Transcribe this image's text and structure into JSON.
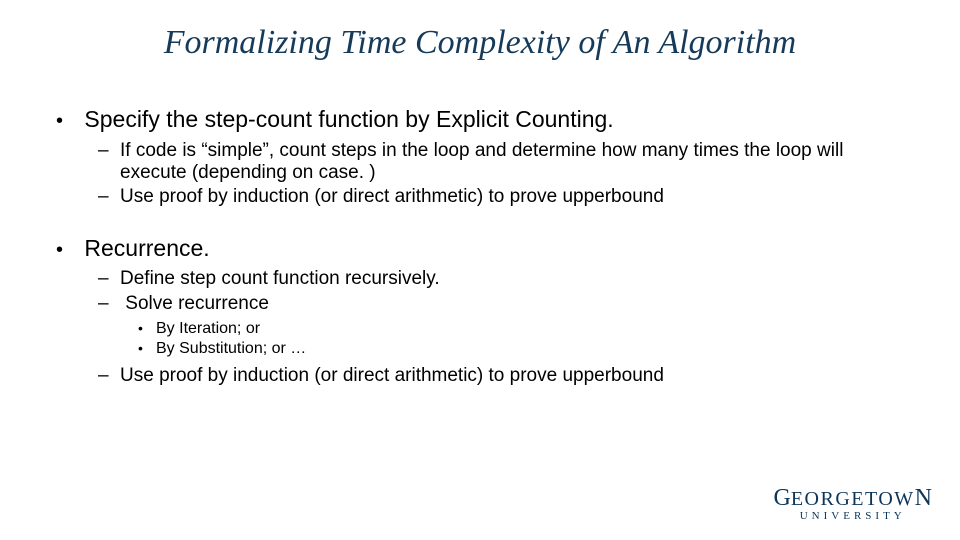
{
  "title": "Formalizing Time Complexity of An Algorithm",
  "bullets": {
    "b1": "Specify the step-count function by Explicit Counting.",
    "b1_1": "If code is “simple”, count steps in the loop and determine how many times the loop will execute (depending on case. )",
    "b1_2": "Use proof by induction (or direct arithmetic) to prove upperbound",
    "b2": "Recurrence.",
    "b2_1": "Define step count function recursively.",
    "b2_2": "Solve recurrence",
    "b2_2_1": "By Iteration; or",
    "b2_2_2": "By Substitution; or …",
    "b2_3": "Use proof by induction (or direct arithmetic) to prove upperbound"
  },
  "logo": {
    "line1a": "G",
    "line1b": "EORGETOW",
    "line1c": "N",
    "line2": "UNIVERSITY"
  }
}
